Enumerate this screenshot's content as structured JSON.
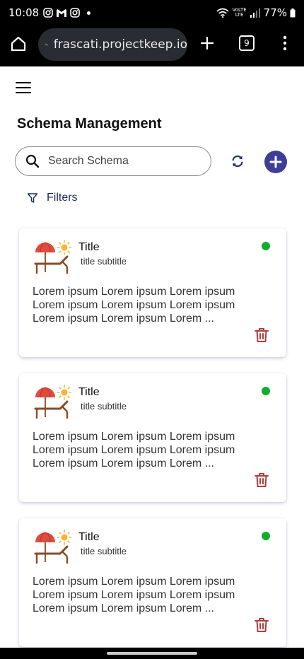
{
  "status_bar": {
    "time": "10:08",
    "battery": "77%",
    "network_label": "LTE"
  },
  "browser": {
    "url": "frascati.projectkeep.io",
    "tab_count": "9"
  },
  "page": {
    "title": "Schema Management",
    "search_placeholder": "Search Schema",
    "filters_label": "Filters"
  },
  "colors": {
    "accent": "#3f3d9a",
    "status_active": "#0db02b",
    "trash": "#b53a3a",
    "umbrella": "#e14b3b",
    "sun": "#f6b52b",
    "chair": "#8b4a24"
  },
  "schemas": [
    {
      "title": "Title",
      "subtitle": "title subtitle",
      "description": "Lorem ipsum Lorem ipsum Lorem ipsum Lorem ipsum Lorem ipsum Lorem ipsum Lorem ipsum Lorem ipsum Lorem ...",
      "icon": "beach-chair-umbrella-sun-icon",
      "status": "active"
    },
    {
      "title": "Title",
      "subtitle": "title subtitle",
      "description": "Lorem ipsum Lorem ipsum Lorem ipsum Lorem ipsum Lorem ipsum Lorem ipsum Lorem ipsum Lorem ipsum Lorem ...",
      "icon": "beach-chair-umbrella-sun-icon",
      "status": "active"
    },
    {
      "title": "Title",
      "subtitle": "title subtitle",
      "description": "Lorem ipsum Lorem ipsum Lorem ipsum Lorem ipsum Lorem ipsum Lorem ipsum Lorem ipsum Lorem ipsum Lorem ...",
      "icon": "beach-chair-umbrella-sun-icon",
      "status": "active"
    }
  ]
}
